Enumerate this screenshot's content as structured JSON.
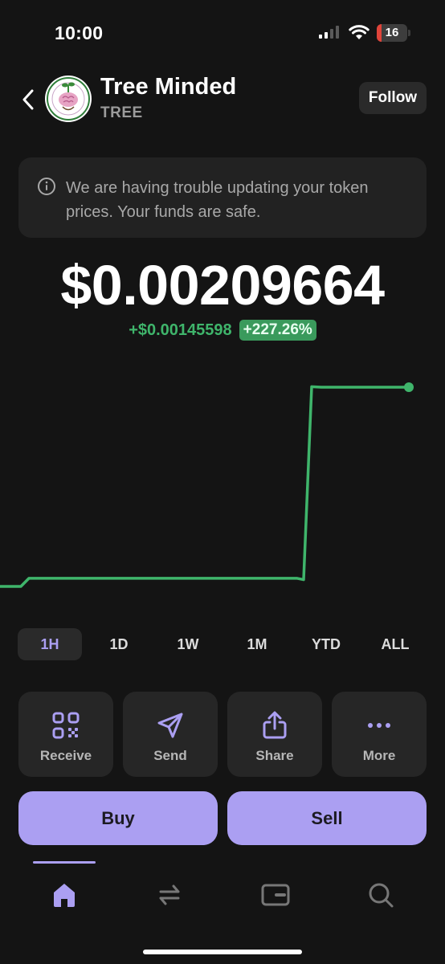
{
  "status_bar": {
    "time": "10:00",
    "battery": "16"
  },
  "header": {
    "token_name": "Tree Minded",
    "token_symbol": "TREE",
    "follow_label": "Follow"
  },
  "banner": {
    "message": "We are having trouble updating your token prices. Your funds are safe."
  },
  "price": {
    "current": "$0.00209664",
    "change_abs": "+$0.00145598",
    "change_pct": "+227.26%"
  },
  "chart_data": {
    "type": "line",
    "series": [
      {
        "values": [
          0.00064066,
          0.00064066,
          0.0007,
          0.0007,
          0.0007,
          0.0007,
          0.0007,
          0.00069,
          0.0021,
          0.00209664,
          0.00209664
        ]
      }
    ],
    "color": "#3fb56b"
  },
  "range_tabs": [
    "1H",
    "1D",
    "1W",
    "1M",
    "YTD",
    "ALL"
  ],
  "active_range": "1H",
  "actions": [
    {
      "label": "Receive",
      "icon": "qr-code-icon"
    },
    {
      "label": "Send",
      "icon": "send-icon"
    },
    {
      "label": "Share",
      "icon": "share-icon"
    },
    {
      "label": "More",
      "icon": "more-icon"
    }
  ],
  "trade": {
    "buy_label": "Buy",
    "sell_label": "Sell"
  },
  "nav": [
    "home-icon",
    "swap-icon",
    "wallet-icon",
    "search-icon"
  ],
  "colors": {
    "accent": "#ab9ff2",
    "positive": "#3fb56b",
    "background": "#141414"
  }
}
